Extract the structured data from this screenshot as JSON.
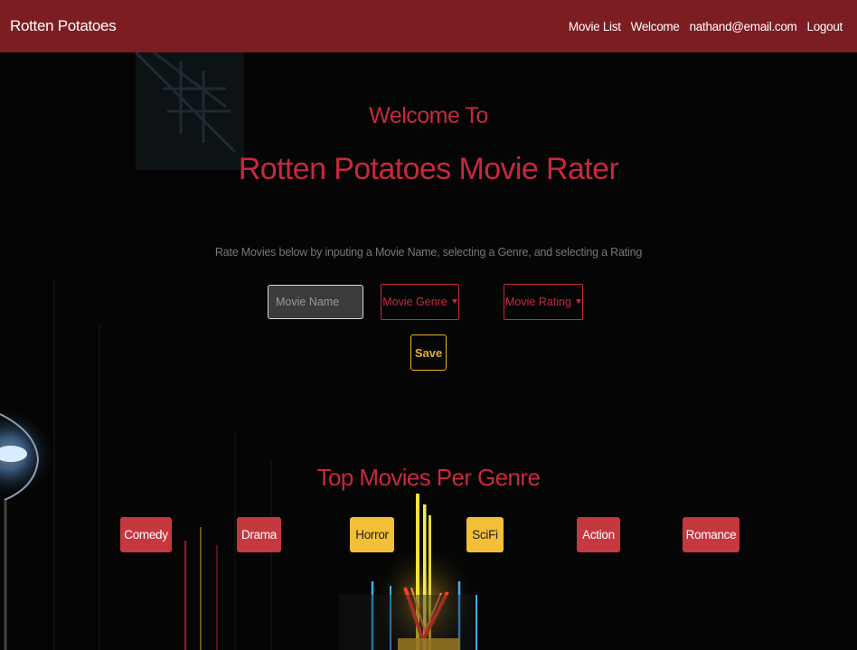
{
  "navbar": {
    "brand": "Rotten Potatoes",
    "links": [
      "Movie List",
      "Welcome",
      "nathand@email.com",
      "Logout"
    ]
  },
  "hero": {
    "welcome": "Welcome To",
    "title": "Rotten Potatoes Movie Rater",
    "instructions": "Rate Movies below by inputing a Movie Name, selecting a Genre, and selecting a Rating"
  },
  "form": {
    "movie_name_placeholder": "Movie Name",
    "movie_name_value": "",
    "genre_label": "Movie Genre",
    "rating_label": "Movie Rating",
    "save_label": "Save"
  },
  "top_movies": {
    "title": "Top Movies Per Genre",
    "genres": [
      "Comedy",
      "Drama",
      "Horror",
      "SciFi",
      "Action",
      "Romance"
    ]
  },
  "colors": {
    "navbar": "#7c1d22",
    "accent_red": "#c8283f",
    "accent_yellow": "#e6b422",
    "button_red": "#c5383f",
    "button_yellow": "#f3bf37"
  }
}
